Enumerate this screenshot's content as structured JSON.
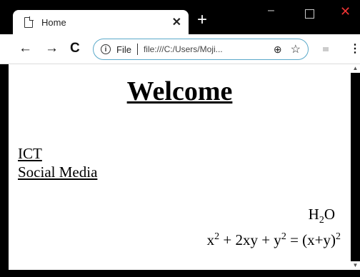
{
  "tab": {
    "title": "Home"
  },
  "toolbar": {
    "file_label": "File",
    "url": "file:///C:/Users/Moji..."
  },
  "page": {
    "heading": "Welcome",
    "links": [
      "ICT",
      "Social Media"
    ],
    "chem": {
      "base": "H",
      "sub": "2",
      "tail": "O"
    },
    "formula": {
      "p1": "x",
      "s1": "2",
      "p2": " + 2xy + y",
      "s2": "2",
      "p3": " = (x+y)",
      "s3": "2"
    }
  },
  "icons": {
    "page": "page-icon",
    "close": "close-icon",
    "new_tab": "plus-icon",
    "minimize": "minimize-icon",
    "maximize": "maximize-icon",
    "window_close": "window-close-icon",
    "back": "back-arrow-icon",
    "forward": "forward-arrow-icon",
    "reload": "reload-icon",
    "info": "info-icon",
    "zoom": "zoom-icon",
    "bookmark": "star-icon",
    "menu": "kebab-menu-icon"
  },
  "colors": {
    "chrome": "#000000",
    "omnibox_border": "#5aa9c9",
    "window_close": "#e33333"
  }
}
